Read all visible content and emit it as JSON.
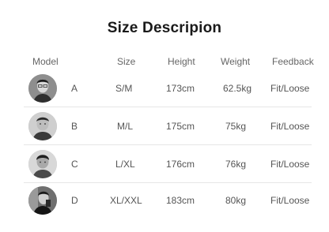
{
  "title": "Size Descripion",
  "headers": {
    "model": "Model",
    "size": "Size",
    "height": "Height",
    "weight": "Weight",
    "feedback": "Feedback"
  },
  "rows": [
    {
      "label": "A",
      "size": "S/M",
      "height": "173cm",
      "weight": "62.5kg",
      "feedback": "Fit/Loose"
    },
    {
      "label": "B",
      "size": "M/L",
      "height": "175cm",
      "weight": "75kg",
      "feedback": "Fit/Loose"
    },
    {
      "label": "C",
      "size": "L/XL",
      "height": "176cm",
      "weight": "76kg",
      "feedback": "Fit/Loose"
    },
    {
      "label": "D",
      "size": "XL/XXL",
      "height": "183cm",
      "weight": "80kg",
      "feedback": "Fit/Loose"
    }
  ]
}
